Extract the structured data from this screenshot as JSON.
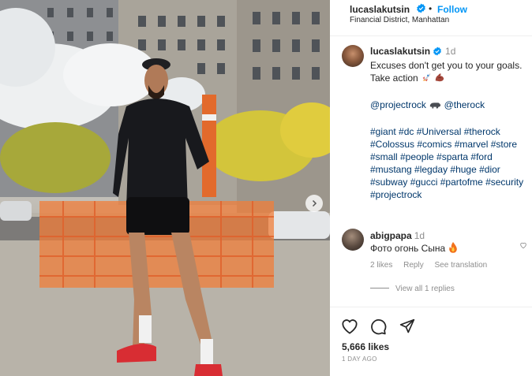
{
  "post": {
    "username": "lucaslakutsin",
    "separator": "•",
    "follow_label": "Follow",
    "location": "Financial District, Manhattan"
  },
  "caption": {
    "username": "lucaslakutsin",
    "time": "1d",
    "lines": [
      "Excuses don't get you to your goals.",
      "Take action"
    ],
    "mentions": [
      "@projectrock",
      "@therock"
    ],
    "hashtag_lines": [
      "#giant #dc #Universal #therock",
      "#Colossus #comics #marvel #store",
      "#small #people #sparta #ford",
      "#mustang #legday #huge #dior",
      "#subway #gucci #partofme #security",
      "#projectrock"
    ]
  },
  "comment": {
    "username": "abigpapa",
    "time": "1d",
    "text": "Фото огонь Сына",
    "likes_label": "2 likes",
    "reply_label": "Reply",
    "translate_label": "See translation",
    "view_replies_label": "View all 1 replies"
  },
  "footer": {
    "likes": "5,666 likes",
    "date": "1 DAY AGO"
  },
  "icons": {
    "verified": "verified-badge-icon",
    "rocket": "rocket-emoji-icon",
    "flexed": "flexed-biceps-emoji-icon",
    "rhino": "rhino-emoji-icon",
    "fire": "fire-emoji-icon",
    "like": "heart-icon",
    "comment": "comment-icon",
    "share": "paper-plane-icon",
    "next": "chevron-right-icon"
  },
  "colors": {
    "link_blue": "#0095f6",
    "hashtag": "#00376b",
    "muted": "#8e8e8e"
  }
}
